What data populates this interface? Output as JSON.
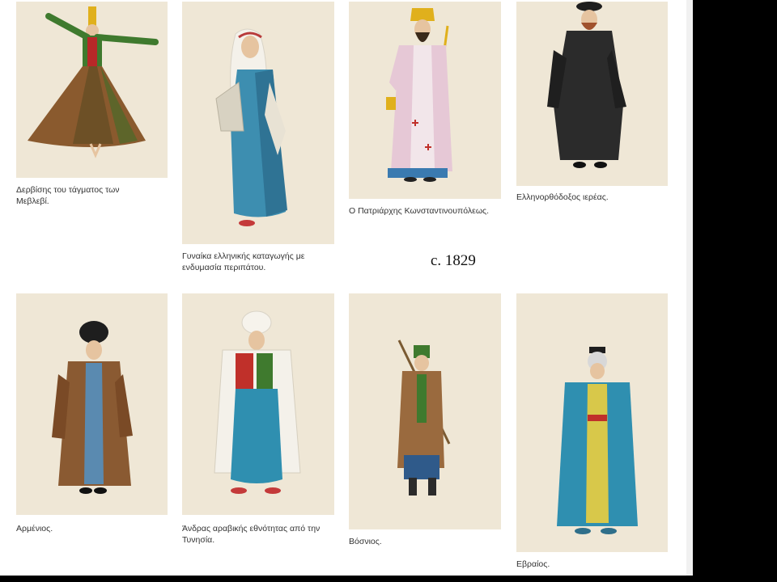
{
  "date_label": "c. 1829",
  "figures": [
    {
      "caption": "Δερβίσης του τάγματος των Μεβλεβί.",
      "image": "whirling-dervish-illustration"
    },
    {
      "caption": "Γυναίκα ελληνικής καταγωγής με ενδυμασία περιπάτου.",
      "image": "greek-woman-illustration"
    },
    {
      "caption": "Ο Πατριάρχης Κωνσταντινουπόλεως.",
      "image": "patriarch-illustration"
    },
    {
      "caption": "Ελληνορθόδοξος ιερέας.",
      "image": "orthodox-priest-illustration"
    },
    {
      "caption": "Αρμένιος.",
      "image": "armenian-man-illustration"
    },
    {
      "caption": "Άνδρας αραβικής εθνότητας από την Τυνησία.",
      "image": "tunisian-man-illustration"
    },
    {
      "caption": "Βόσνιος.",
      "image": "bosnian-man-illustration"
    },
    {
      "caption": "Εβραίος.",
      "image": "jewish-man-illustration"
    }
  ],
  "colors": {
    "paper": "#efe7d6",
    "caption_text": "#333333",
    "background": "#000000"
  }
}
